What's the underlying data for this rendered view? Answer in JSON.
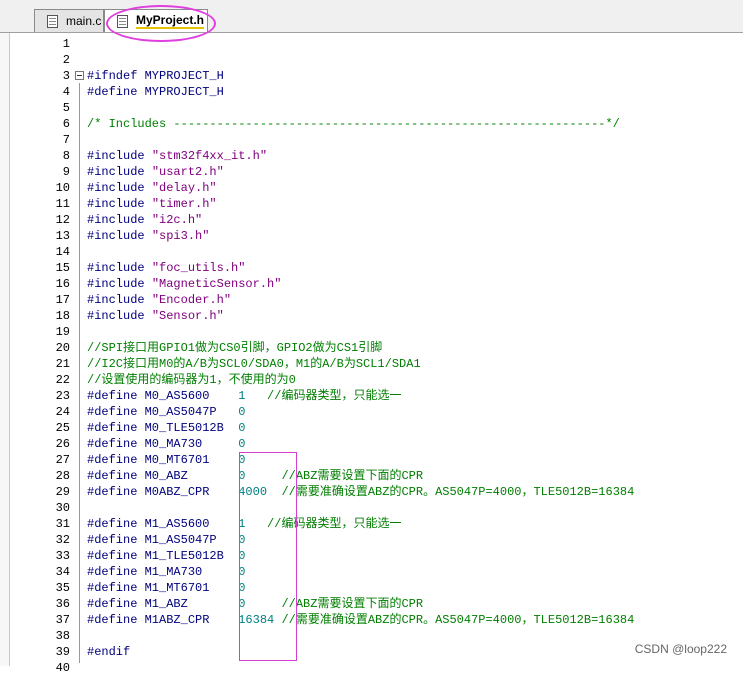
{
  "tabs": [
    {
      "label": "main.c",
      "active": false
    },
    {
      "label": "MyProject.h",
      "active": true
    }
  ],
  "lines": [
    {
      "n": "1",
      "segments": []
    },
    {
      "n": "2",
      "segments": []
    },
    {
      "n": "3",
      "fold": true,
      "segments": [
        {
          "t": "#ifndef ",
          "c": "kw"
        },
        {
          "t": "MYPROJECT_H",
          "c": "kw"
        }
      ]
    },
    {
      "n": "4",
      "segments": [
        {
          "t": "#define ",
          "c": "kw"
        },
        {
          "t": "MYPROJECT_H",
          "c": "kw"
        }
      ]
    },
    {
      "n": "5",
      "segments": []
    },
    {
      "n": "6",
      "segments": [
        {
          "t": "/* Includes ------------------------------------------------------------*/",
          "c": "cmt"
        }
      ]
    },
    {
      "n": "7",
      "segments": []
    },
    {
      "n": "8",
      "segments": [
        {
          "t": "#include ",
          "c": "kw"
        },
        {
          "t": "\"stm32f4xx_it.h\"",
          "c": "str"
        }
      ]
    },
    {
      "n": "9",
      "segments": [
        {
          "t": "#include ",
          "c": "kw"
        },
        {
          "t": "\"usart2.h\"",
          "c": "str"
        }
      ]
    },
    {
      "n": "10",
      "segments": [
        {
          "t": "#include ",
          "c": "kw"
        },
        {
          "t": "\"delay.h\"",
          "c": "str"
        }
      ]
    },
    {
      "n": "11",
      "segments": [
        {
          "t": "#include ",
          "c": "kw"
        },
        {
          "t": "\"timer.h\"",
          "c": "str"
        }
      ]
    },
    {
      "n": "12",
      "segments": [
        {
          "t": "#include ",
          "c": "kw"
        },
        {
          "t": "\"i2c.h\"",
          "c": "str"
        }
      ]
    },
    {
      "n": "13",
      "segments": [
        {
          "t": "#include ",
          "c": "kw"
        },
        {
          "t": "\"spi3.h\"",
          "c": "str"
        }
      ]
    },
    {
      "n": "14",
      "segments": []
    },
    {
      "n": "15",
      "segments": [
        {
          "t": "#include ",
          "c": "kw"
        },
        {
          "t": "\"foc_utils.h\"",
          "c": "str"
        }
      ]
    },
    {
      "n": "16",
      "segments": [
        {
          "t": "#include ",
          "c": "kw"
        },
        {
          "t": "\"MagneticSensor.h\"",
          "c": "str"
        }
      ]
    },
    {
      "n": "17",
      "segments": [
        {
          "t": "#include ",
          "c": "kw"
        },
        {
          "t": "\"Encoder.h\"",
          "c": "str"
        }
      ]
    },
    {
      "n": "18",
      "segments": [
        {
          "t": "#include ",
          "c": "kw"
        },
        {
          "t": "\"Sensor.h\"",
          "c": "str"
        }
      ]
    },
    {
      "n": "19",
      "segments": []
    },
    {
      "n": "20",
      "segments": [
        {
          "t": "//SPI接口用GPIO1做为CS0引脚，GPIO2做为CS1引脚",
          "c": "cmt"
        }
      ]
    },
    {
      "n": "21",
      "segments": [
        {
          "t": "//I2C接口用M0的A/B为SCL0/SDA0，M1的A/B为SCL1/SDA1",
          "c": "cmt"
        }
      ]
    },
    {
      "n": "22",
      "segments": [
        {
          "t": "//设置使用的编码器为1，不使用的为0",
          "c": "cmt"
        }
      ]
    },
    {
      "n": "23",
      "segments": [
        {
          "t": "#define ",
          "c": "kw"
        },
        {
          "t": "M0_AS5600    ",
          "c": "kw"
        },
        {
          "t": "1   ",
          "c": "num"
        },
        {
          "t": "//编码器类型，只能选一",
          "c": "cmt"
        }
      ]
    },
    {
      "n": "24",
      "segments": [
        {
          "t": "#define ",
          "c": "kw"
        },
        {
          "t": "M0_AS5047P   ",
          "c": "kw"
        },
        {
          "t": "0",
          "c": "num"
        }
      ]
    },
    {
      "n": "25",
      "segments": [
        {
          "t": "#define ",
          "c": "kw"
        },
        {
          "t": "M0_TLE5012B  ",
          "c": "kw"
        },
        {
          "t": "0",
          "c": "num"
        }
      ]
    },
    {
      "n": "26",
      "segments": [
        {
          "t": "#define ",
          "c": "kw"
        },
        {
          "t": "M0_MA730     ",
          "c": "kw"
        },
        {
          "t": "0",
          "c": "num"
        }
      ]
    },
    {
      "n": "27",
      "segments": [
        {
          "t": "#define ",
          "c": "kw"
        },
        {
          "t": "M0_MT6701    ",
          "c": "kw"
        },
        {
          "t": "0",
          "c": "num"
        }
      ]
    },
    {
      "n": "28",
      "segments": [
        {
          "t": "#define ",
          "c": "kw"
        },
        {
          "t": "M0_ABZ       ",
          "c": "kw"
        },
        {
          "t": "0     ",
          "c": "num"
        },
        {
          "t": "//ABZ需要设置下面的CPR",
          "c": "cmt"
        }
      ]
    },
    {
      "n": "29",
      "segments": [
        {
          "t": "#define ",
          "c": "kw"
        },
        {
          "t": "M0ABZ_CPR    ",
          "c": "kw"
        },
        {
          "t": "4000  ",
          "c": "num"
        },
        {
          "t": "//需要准确设置ABZ的CPR。AS5047P=4000，TLE5012B=16384",
          "c": "cmt"
        }
      ]
    },
    {
      "n": "30",
      "segments": []
    },
    {
      "n": "31",
      "segments": [
        {
          "t": "#define ",
          "c": "kw"
        },
        {
          "t": "M1_AS5600    ",
          "c": "kw"
        },
        {
          "t": "1   ",
          "c": "num"
        },
        {
          "t": "//编码器类型，只能选一",
          "c": "cmt"
        }
      ]
    },
    {
      "n": "32",
      "segments": [
        {
          "t": "#define ",
          "c": "kw"
        },
        {
          "t": "M1_AS5047P   ",
          "c": "kw"
        },
        {
          "t": "0",
          "c": "num"
        }
      ]
    },
    {
      "n": "33",
      "segments": [
        {
          "t": "#define ",
          "c": "kw"
        },
        {
          "t": "M1_TLE5012B  ",
          "c": "kw"
        },
        {
          "t": "0",
          "c": "num"
        }
      ]
    },
    {
      "n": "34",
      "segments": [
        {
          "t": "#define ",
          "c": "kw"
        },
        {
          "t": "M1_MA730     ",
          "c": "kw"
        },
        {
          "t": "0",
          "c": "num"
        }
      ]
    },
    {
      "n": "35",
      "segments": [
        {
          "t": "#define ",
          "c": "kw"
        },
        {
          "t": "M1_MT6701    ",
          "c": "kw"
        },
        {
          "t": "0",
          "c": "num"
        }
      ]
    },
    {
      "n": "36",
      "segments": [
        {
          "t": "#define ",
          "c": "kw"
        },
        {
          "t": "M1_ABZ       ",
          "c": "kw"
        },
        {
          "t": "0     ",
          "c": "num"
        },
        {
          "t": "//ABZ需要设置下面的CPR",
          "c": "cmt"
        }
      ]
    },
    {
      "n": "37",
      "segments": [
        {
          "t": "#define ",
          "c": "kw"
        },
        {
          "t": "M1ABZ_CPR    ",
          "c": "kw"
        },
        {
          "t": "16384 ",
          "c": "num"
        },
        {
          "t": "//需要准确设置ABZ的CPR。AS5047P=4000，TLE5012B=16384",
          "c": "cmt"
        }
      ]
    },
    {
      "n": "38",
      "segments": []
    },
    {
      "n": "39",
      "segments": [
        {
          "t": "#endif",
          "c": "kw"
        }
      ]
    },
    {
      "n": "40",
      "segments": []
    }
  ],
  "watermark": "CSDN @loop222"
}
